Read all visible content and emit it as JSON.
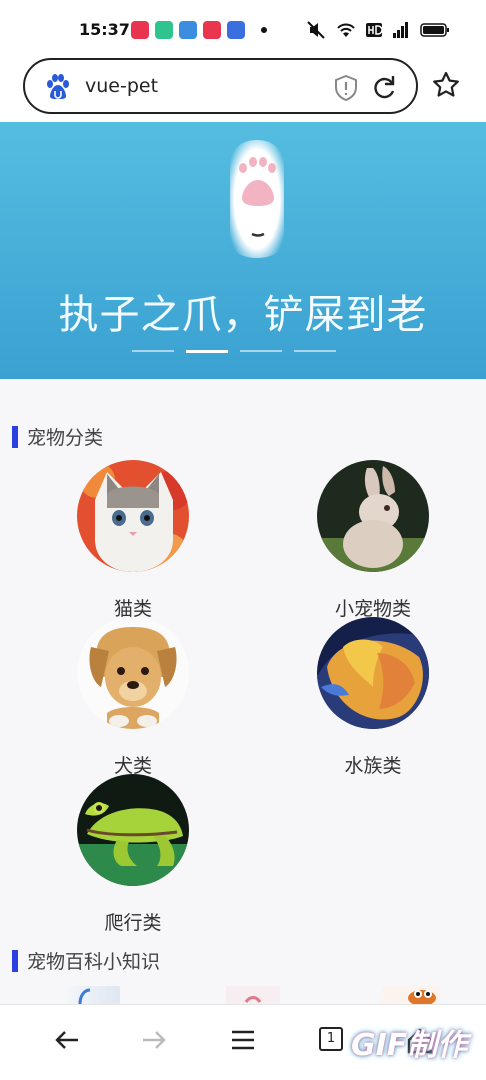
{
  "status_bar": {
    "time": "15:37"
  },
  "browser": {
    "url": "vue-pet"
  },
  "banner": {
    "slogan": "执子之爪，铲屎到老",
    "slides": [
      false,
      true,
      false,
      false
    ]
  },
  "sections": {
    "categories_title": "宠物分类",
    "categories": [
      {
        "label": "猫类",
        "icon": "cat-photo"
      },
      {
        "label": "小宠物类",
        "icon": "rabbit-photo"
      },
      {
        "label": "犬类",
        "icon": "dog-photo"
      },
      {
        "label": "水族类",
        "icon": "fish-photo"
      },
      {
        "label": "爬行类",
        "icon": "frog-photo"
      }
    ],
    "knowledge_title": "宠物百科小知识"
  },
  "bottom_nav": {
    "tab_count": "1"
  },
  "watermark": "GIF制作",
  "colors": {
    "banner": "#4ab2dc",
    "accent_bar": "#2c3fe0"
  }
}
